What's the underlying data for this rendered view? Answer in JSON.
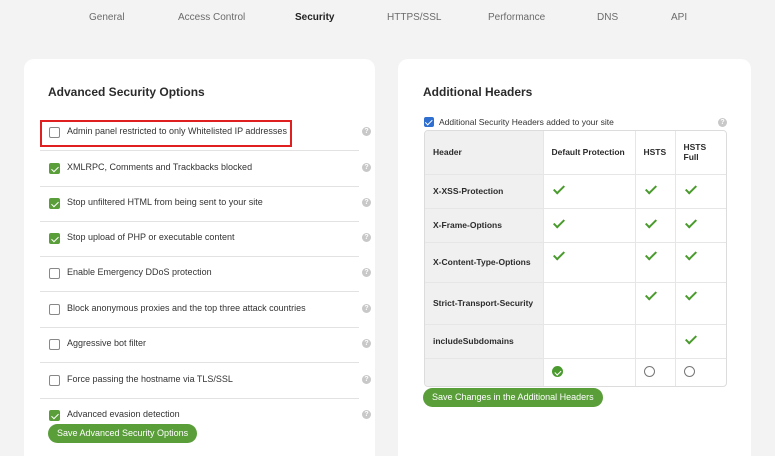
{
  "nav": {
    "tabs": [
      {
        "label": "General"
      },
      {
        "label": "Access Control"
      },
      {
        "label": "Security"
      },
      {
        "label": "HTTPS/SSL"
      },
      {
        "label": "Performance"
      },
      {
        "label": "DNS"
      },
      {
        "label": "API"
      }
    ],
    "active_tab": "Security"
  },
  "advanced_security": {
    "title": "Advanced Security Options",
    "options": [
      {
        "label": "Admin panel restricted to only Whitelisted IP addresses",
        "checked": false
      },
      {
        "label": "XMLRPC, Comments and Trackbacks blocked",
        "checked": true
      },
      {
        "label": "Stop unfiltered HTML from being sent to your site",
        "checked": true
      },
      {
        "label": "Stop upload of PHP or executable content",
        "checked": true
      },
      {
        "label": "Enable Emergency DDoS protection",
        "checked": false
      },
      {
        "label": "Block anonymous proxies and the top three attack countries",
        "checked": false
      },
      {
        "label": "Aggressive bot filter",
        "checked": false
      },
      {
        "label": "Force passing the hostname via TLS/SSL",
        "checked": false
      },
      {
        "label": "Advanced evasion detection",
        "checked": true
      }
    ],
    "help_glyph": "?",
    "save_label": "Save Advanced Security Options"
  },
  "additional_headers": {
    "title": "Additional Headers",
    "enable_label": "Additional Security Headers added to your site",
    "enable_checked": true,
    "columns": [
      "Header",
      "Default Protection",
      "HSTS",
      "HSTS Full"
    ],
    "rows": [
      {
        "name": "X-XSS-Protection",
        "default": true,
        "hsts": true,
        "hsts_full": true
      },
      {
        "name": "X-Frame-Options",
        "default": true,
        "hsts": true,
        "hsts_full": true
      },
      {
        "name": "X-Content-Type-Options",
        "default": true,
        "hsts": true,
        "hsts_full": true
      },
      {
        "name": "Strict-Transport-Security",
        "default": false,
        "hsts": true,
        "hsts_full": true
      },
      {
        "name": "includeSubdomains",
        "default": false,
        "hsts": false,
        "hsts_full": true
      }
    ],
    "selected_profile": "Default Protection",
    "save_label": "Save Changes in the Additional Headers"
  },
  "colors": {
    "accent": "#5a9e3a",
    "highlight": "#e02020",
    "checkbox_blue": "#2f6fd0"
  }
}
